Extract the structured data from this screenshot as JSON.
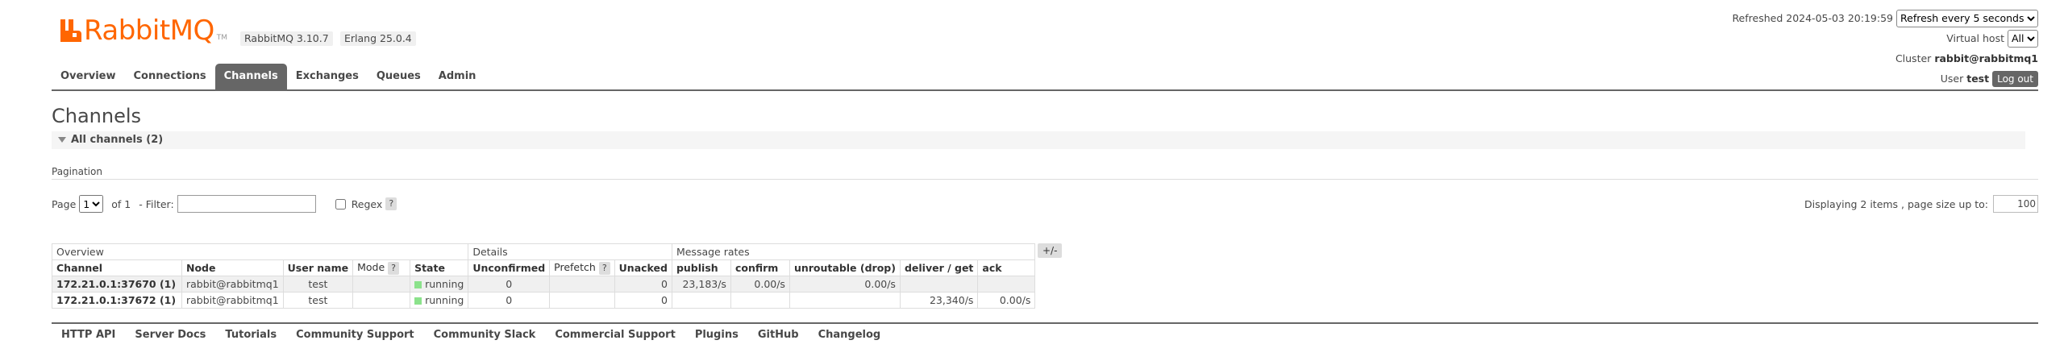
{
  "header": {
    "logo_text": "RabbitMQ",
    "logo_tm": "TM",
    "version": "RabbitMQ 3.10.7",
    "erlang": "Erlang 25.0.4",
    "refreshed_label": "Refreshed 2024-05-03 20:19:59",
    "refresh_option": "Refresh every 5 seconds",
    "vhost_label": "Virtual host",
    "vhost_value": "All",
    "cluster_label": "Cluster",
    "cluster_value": "rabbit@rabbitmq1",
    "user_label": "User",
    "user_value": "test",
    "logout_label": "Log out",
    "brand_color": "#ff6600"
  },
  "tabs": [
    {
      "label": "Overview"
    },
    {
      "label": "Connections"
    },
    {
      "label": "Channels",
      "active": true
    },
    {
      "label": "Exchanges"
    },
    {
      "label": "Queues"
    },
    {
      "label": "Admin"
    }
  ],
  "page": {
    "title": "Channels",
    "section": "All channels (2)",
    "pagination_label": "Pagination",
    "page_label": "Page",
    "page_value": "1",
    "of_label": "of 1",
    "filter_label": "- Filter:",
    "filter_value": "",
    "regex_label": "Regex",
    "help": "?",
    "display_info": "Displaying 2 items , page size up to:",
    "page_size": "100"
  },
  "table": {
    "groups": [
      "Overview",
      "Details",
      "Message rates"
    ],
    "plus_minus": "+/-",
    "columns": [
      "Channel",
      "Node",
      "User name",
      "Mode",
      "State",
      "Unconfirmed",
      "Prefetch",
      "Unacked",
      "publish",
      "confirm",
      "unroutable (drop)",
      "deliver / get",
      "ack"
    ],
    "rows": [
      {
        "channel": "172.21.0.1:37670 (1)",
        "node": "rabbit@rabbitmq1",
        "user": "test",
        "mode": "",
        "state": "running",
        "unconfirmed": "0",
        "prefetch": "",
        "unacked": "0",
        "publish": "23,183/s",
        "confirm": "0.00/s",
        "unroutable": "0.00/s",
        "deliver": "",
        "ack": ""
      },
      {
        "channel": "172.21.0.1:37672 (1)",
        "node": "rabbit@rabbitmq1",
        "user": "test",
        "mode": "",
        "state": "running",
        "unconfirmed": "0",
        "prefetch": "",
        "unacked": "0",
        "publish": "",
        "confirm": "",
        "unroutable": "",
        "deliver": "23,340/s",
        "ack": "0.00/s"
      }
    ],
    "state_color": "#8be28b"
  },
  "footer": [
    "HTTP API",
    "Server Docs",
    "Tutorials",
    "Community Support",
    "Community Slack",
    "Commercial Support",
    "Plugins",
    "GitHub",
    "Changelog"
  ]
}
